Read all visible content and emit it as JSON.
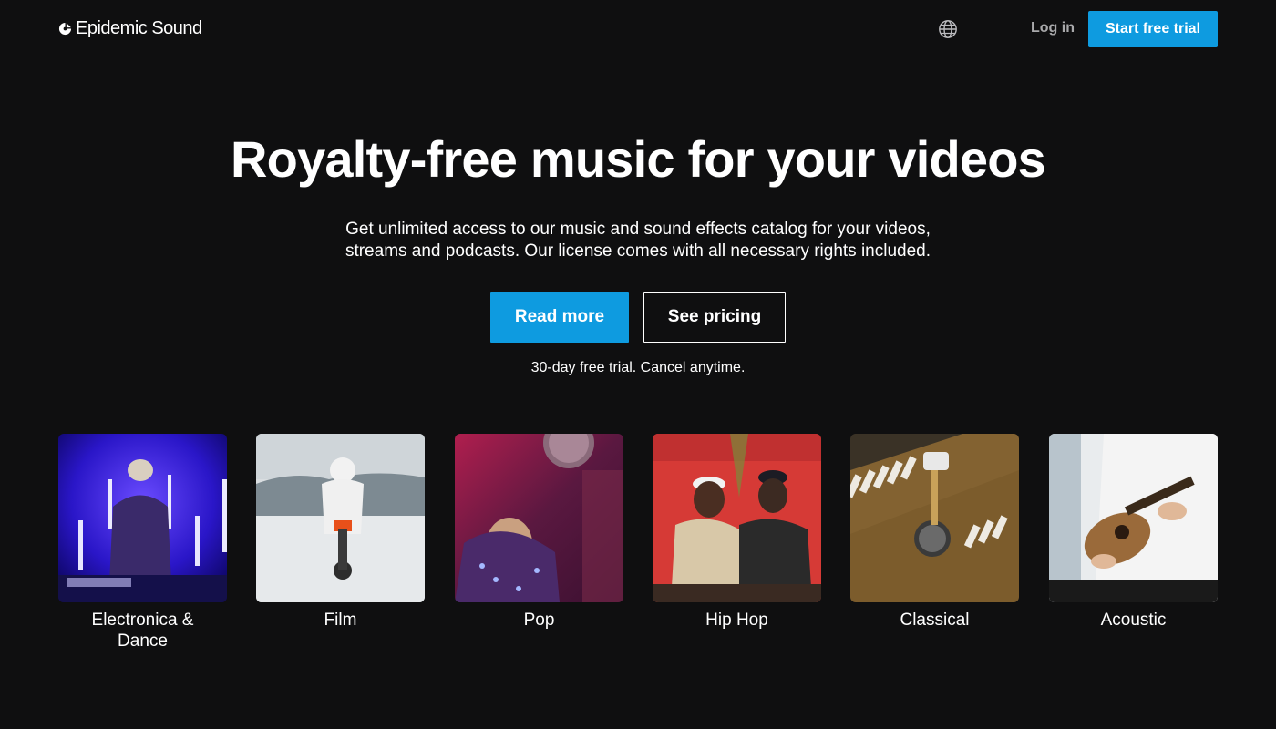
{
  "header": {
    "logo_text": "Epidemic Sound",
    "logo_icon": "epidemic-sound-logo-icon",
    "language_icon": "globe-icon",
    "login_label": "Log in",
    "trial_label": "Start free trial"
  },
  "hero": {
    "title": "Royalty-free music for your videos",
    "subtitle_line1": "Get unlimited access to our music and sound effects catalog for your videos,",
    "subtitle_line2": "streams and podcasts. Our license comes with all necessary rights included.",
    "read_more_label": "Read more",
    "see_pricing_label": "See pricing",
    "trial_note": "30-day free trial. Cancel anytime."
  },
  "genres": [
    {
      "label": "Electronica &",
      "label2": "Dance"
    },
    {
      "label": "Film",
      "label2": ""
    },
    {
      "label": "Pop",
      "label2": ""
    },
    {
      "label": "Hip Hop",
      "label2": ""
    },
    {
      "label": "Classical",
      "label2": ""
    },
    {
      "label": "Acoustic",
      "label2": ""
    }
  ],
  "colors": {
    "background": "#0f0f10",
    "accent": "#0e9be0",
    "muted_text": "#a9a9ab"
  }
}
